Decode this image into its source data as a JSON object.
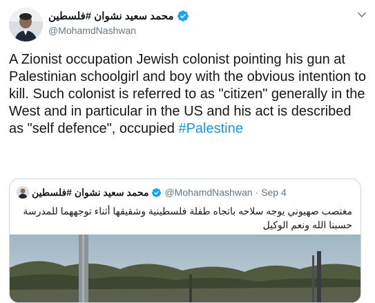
{
  "tweet": {
    "author": {
      "display_name": "محمد سعيد نشوان #فلسطين",
      "handle": "@MohamdNashwan"
    },
    "text_main": "A Zionist occupation Jewish colonist pointing his gun at Palestinian schoolgirl and boy with the obvious intention to kill. Such colonist is referred to as \"citizen\" generally in the West and in particular in the US and his act is described as \"self defence\", occupied ",
    "hashtag": "#Palestine"
  },
  "quoted": {
    "display_name": "محمد سعيد نشوان #فلسطين",
    "handle": "@MohamdNashwan",
    "separator": "·",
    "date": "Sep 4",
    "text_line1": "مغتصب صهيوني يوجه سلاحه باتجاه طفلة فلسطينية وشقيقها أثناء توجههما للمدرسة",
    "text_line2": "حسبنا الله ونعم الوكيل"
  },
  "colors": {
    "link": "#1b95e0",
    "verified": "#1da1f2",
    "secondary_text": "#657786",
    "border": "#ccd6dd"
  },
  "icons": [
    "verified-badge-icon",
    "chevron-down-icon"
  ]
}
